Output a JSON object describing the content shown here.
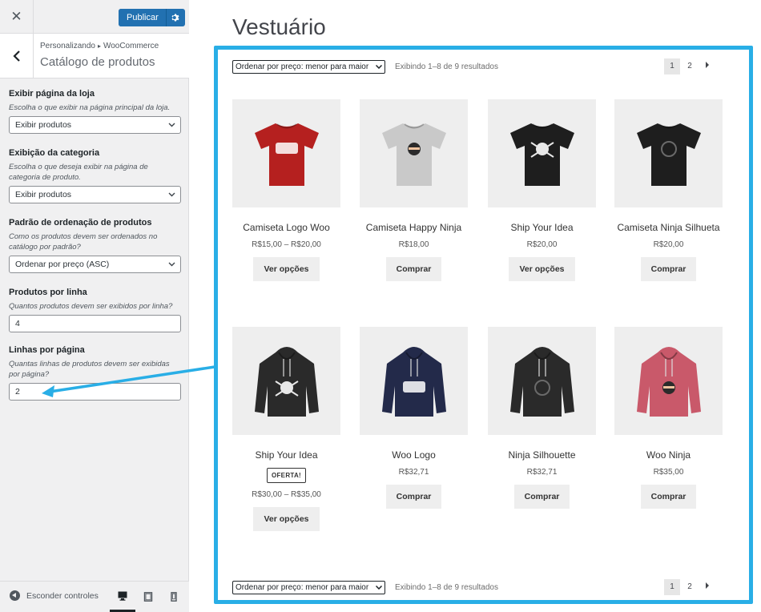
{
  "sidebar": {
    "publish_label": "Publicar",
    "breadcrumb": [
      "Personalizando",
      "WooCommerce"
    ],
    "section_title": "Catálogo de produtos",
    "controls": [
      {
        "label": "Exibir página da loja",
        "description": "Escolha o que exibir na página principal da loja.",
        "value": "Exibir produtos"
      },
      {
        "label": "Exibição da categoria",
        "description": "Escolha o que deseja exibir na página de categoria de produto.",
        "value": "Exibir produtos"
      },
      {
        "label": "Padrão de ordenação de produtos",
        "description": "Como os produtos devem ser ordenados no catálogo por padrão?",
        "value": "Ordenar por preço (ASC)"
      },
      {
        "label": "Produtos por linha",
        "description": "Quantos produtos devem ser exibidos por linha?",
        "value": "4"
      },
      {
        "label": "Linhas por página",
        "description": "Quantas linhas de produtos devem ser exibidas por página?",
        "value": "2"
      }
    ],
    "hide_controls_label": "Esconder controles"
  },
  "preview": {
    "page_title": "Vestuário",
    "ordering_value": "Ordenar por preço: menor para maior",
    "result_count": "Exibindo 1–8 de 9 resultados",
    "pages": [
      "1",
      "2"
    ],
    "highlight_color": "#29aee6",
    "accent_color": "#2271b1",
    "products": [
      {
        "title": "Camiseta Logo Woo",
        "price": "R$15,00 – R$20,00",
        "button": "Ver opções",
        "badge": "",
        "kind": "tshirt",
        "color": "#b5201f",
        "print": "Woo"
      },
      {
        "title": "Camiseta Happy Ninja",
        "price": "R$18,00",
        "button": "Comprar",
        "badge": "",
        "kind": "tshirt",
        "color": "#c9c9c9",
        "print": "ninja"
      },
      {
        "title": "Ship Your Idea",
        "price": "R$20,00",
        "button": "Ver opções",
        "badge": "",
        "kind": "tshirt",
        "color": "#1e1e1e",
        "print": "skull"
      },
      {
        "title": "Camiseta Ninja Silhueta",
        "price": "R$20,00",
        "button": "Comprar",
        "badge": "",
        "kind": "tshirt",
        "color": "#1e1e1e",
        "print": "silhouette"
      },
      {
        "title": "Ship Your Idea",
        "price": "R$30,00 – R$35,00",
        "button": "Ver opções",
        "badge": "OFERTA!",
        "kind": "hoodie",
        "color": "#2a2a2a",
        "print": "skull"
      },
      {
        "title": "Woo Logo",
        "price": "R$32,71",
        "button": "Comprar",
        "badge": "",
        "kind": "hoodie",
        "color": "#232a4a",
        "print": "Woo"
      },
      {
        "title": "Ninja Silhouette",
        "price": "R$32,71",
        "button": "Comprar",
        "badge": "",
        "kind": "hoodie",
        "color": "#2a2a2a",
        "print": "silhouette"
      },
      {
        "title": "Woo Ninja",
        "price": "R$35,00",
        "button": "Comprar",
        "badge": "",
        "kind": "hoodie",
        "color": "#c9596a",
        "print": "ninja"
      }
    ]
  }
}
